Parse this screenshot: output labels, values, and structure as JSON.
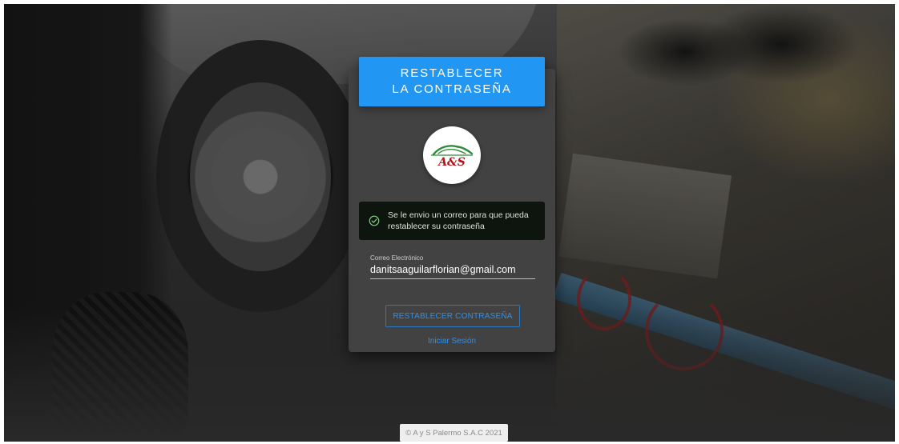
{
  "header": {
    "title": "RESTABLECER LA CONTRASEÑA"
  },
  "logo": {
    "text": "A&S",
    "name": "a-and-s-logo"
  },
  "alert": {
    "icon": "check-circle-icon",
    "message": "Se le envio un correo para que pueda restablecer su contraseña",
    "color": "#0e140e"
  },
  "form": {
    "email_label": "Correo Electrónico",
    "email_value": "danitsaaguilarflorian@gmail.com",
    "submit_label": "RESTABLECER CONTRASEÑA",
    "login_link": "Iniciar Sesión"
  },
  "footer": {
    "text": "© A y S Palermo S.A.C 2021"
  },
  "colors": {
    "accent": "#2196f3",
    "card_bg": "#424242",
    "link": "#2f8fe6"
  }
}
